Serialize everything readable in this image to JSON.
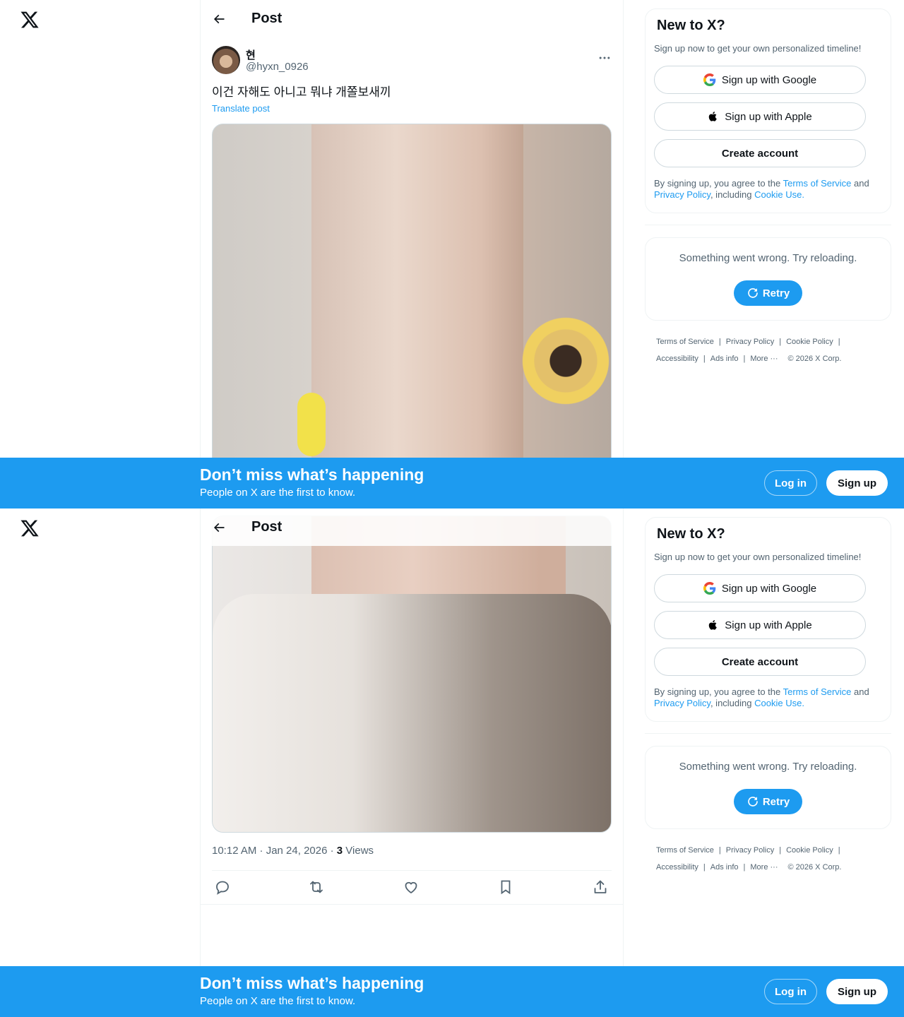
{
  "topbar": {
    "title": "Post"
  },
  "post": {
    "display_name": "현",
    "handle": "@hyxn_0926",
    "text": "이건 자해도 아니고 뭐냐 개쫄보새끼",
    "translate_label": "Translate post",
    "time": "10:12 AM · Jan 24, 2026 · ",
    "views_count": "3",
    "views_label": " Views"
  },
  "signup": {
    "title": "New to X?",
    "subtitle": "Sign up now to get your own personalized timeline!",
    "google": "Sign up with Google",
    "apple": "Sign up with Apple",
    "create": "Create account",
    "terms_prefix": "By signing up, you agree to the ",
    "terms_link": "Terms of Service",
    "terms_and": " and ",
    "privacy_link": "Privacy Policy",
    "terms_including": ", including ",
    "cookie_link": "Cookie Use",
    "terms_end": "."
  },
  "error": {
    "message": "Something went wrong. Try reloading.",
    "retry": "Retry"
  },
  "footer": {
    "terms": "Terms of Service",
    "privacy": "Privacy Policy",
    "cookie": "Cookie Policy",
    "accessibility": "Accessibility",
    "ads": "Ads info",
    "more": "More ···",
    "copyright": "© 2026 X Corp."
  },
  "banner": {
    "title": "Don’t miss what’s happening",
    "subtitle": "People on X are the first to know.",
    "login": "Log in",
    "signup": "Sign up"
  },
  "colors": {
    "accent": "#1d9bf0",
    "text": "#0f1419",
    "muted": "#536471",
    "border": "#eff3f4"
  }
}
